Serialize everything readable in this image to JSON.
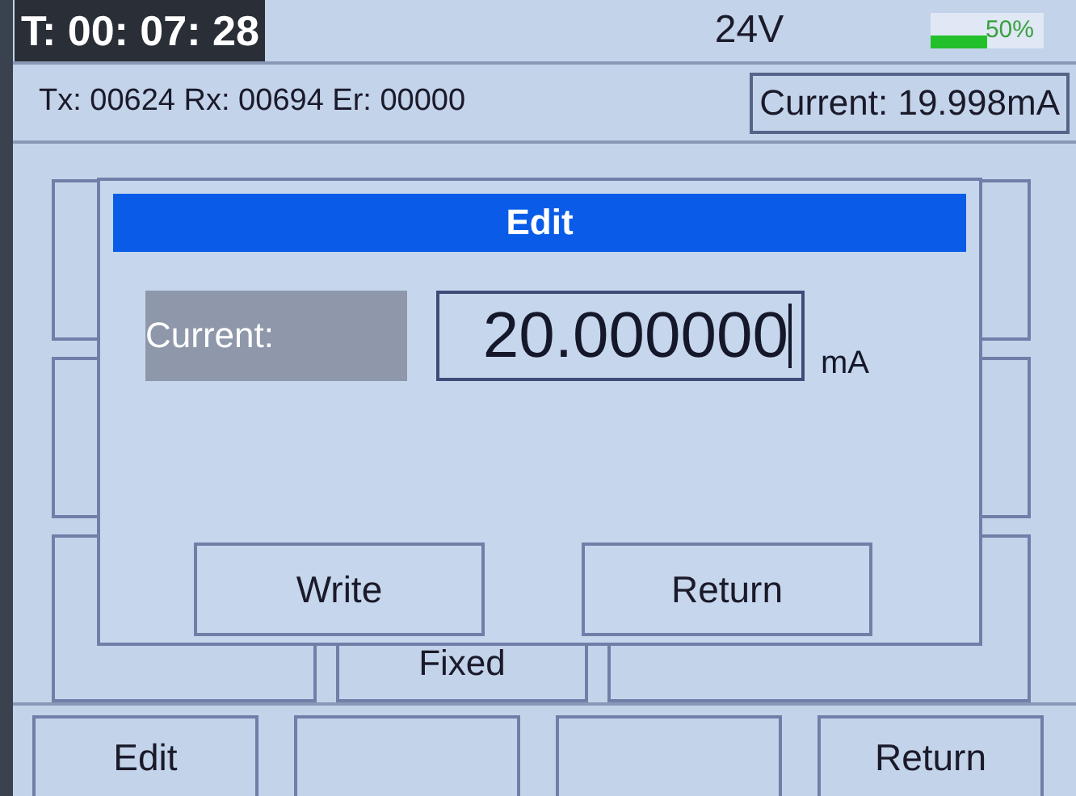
{
  "status_bar": {
    "timer": "T: 00: 07: 28",
    "voltage": "24V",
    "battery": {
      "level": 0.5,
      "label": "50%"
    }
  },
  "counters": "Tx: 00624 Rx: 00694 Er: 00000",
  "reading": "Current: 19.998mA",
  "background_button": {
    "label": "Fixed"
  },
  "softkeys": [
    {
      "kind": "label",
      "label": "Edit"
    },
    {
      "kind": "blank"
    },
    {
      "kind": "blank"
    },
    {
      "kind": "label",
      "label": "Return"
    }
  ],
  "dialog": {
    "title": "Edit",
    "field_label": "Current:",
    "value": "20.000000",
    "unit": "mA",
    "buttons": [
      "Write",
      "Return"
    ]
  }
}
